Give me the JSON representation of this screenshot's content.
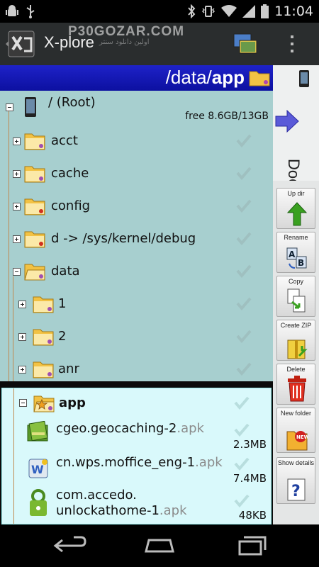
{
  "status_bar": {
    "time": "11:04"
  },
  "action_bar": {
    "title": "X-plore",
    "watermark": "P30GOZAR.COM",
    "watermark_sub": "اولین دانلود سنتر"
  },
  "path_bar": {
    "prefix": "/data/",
    "current": "app"
  },
  "root": {
    "label": "/ (Root)",
    "free": "free 8.6GB/13GB"
  },
  "tree": [
    {
      "label": "acct",
      "kind": "folder"
    },
    {
      "label": "cache",
      "kind": "folder"
    },
    {
      "label": "config",
      "kind": "folder-red"
    },
    {
      "label": "d -> /sys/kernel/debug",
      "kind": "folder-red"
    },
    {
      "label": "data",
      "kind": "folder-open"
    },
    {
      "label": "1",
      "kind": "folder"
    },
    {
      "label": "2",
      "kind": "folder"
    },
    {
      "label": "anr",
      "kind": "folder"
    }
  ],
  "app_folder": {
    "label": "app"
  },
  "files": [
    {
      "name": "cgeo.geocaching-2",
      "ext": ".apk",
      "size": "2.3MB"
    },
    {
      "name": "cn.wps.moffice_eng-1",
      "ext": ".apk",
      "size": "7.4MB"
    },
    {
      "name": "com.accedo.",
      "name2": "unlockathome-1",
      "ext": ".apk",
      "size": "48KB"
    }
  ],
  "side": {
    "docs_label": "Docs",
    "tools": [
      {
        "label": "Up dir"
      },
      {
        "label": "Rename"
      },
      {
        "label": "Copy"
      },
      {
        "label": "Create ZIP"
      },
      {
        "label": "Delete"
      },
      {
        "label": "New folder"
      },
      {
        "label": "Show details"
      }
    ]
  }
}
